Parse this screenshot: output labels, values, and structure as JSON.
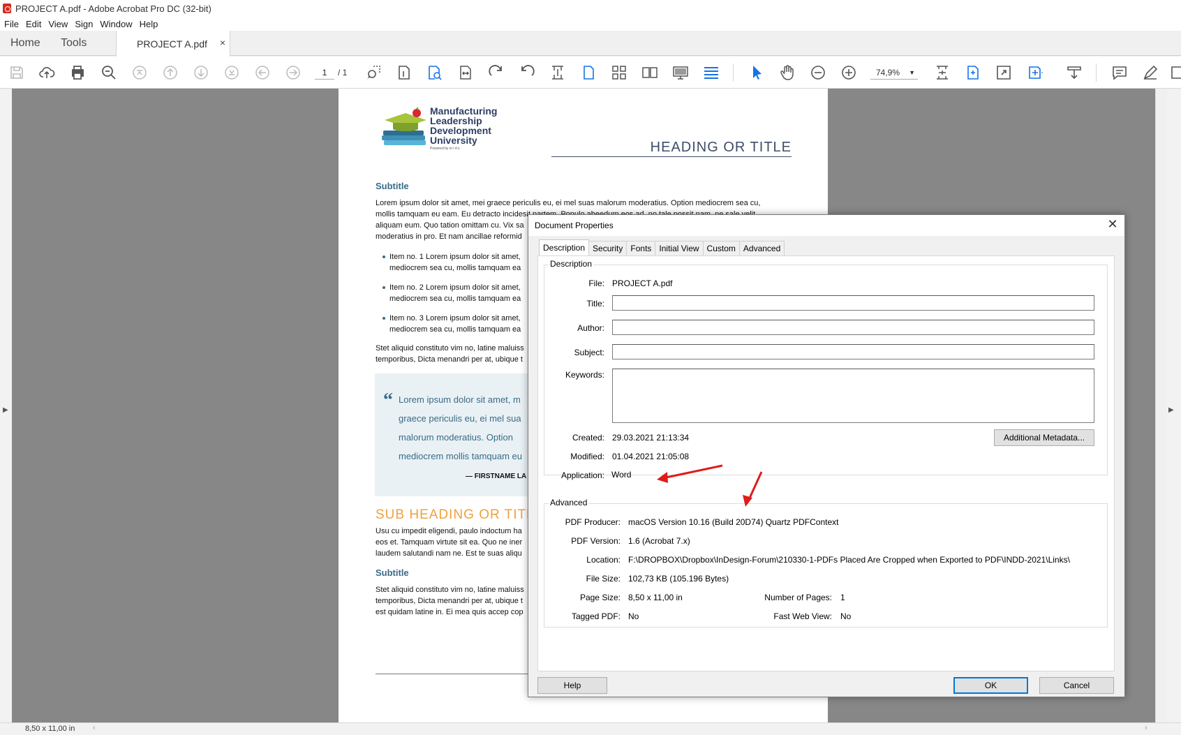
{
  "window": {
    "title": "PROJECT A.pdf - Adobe Acrobat Pro DC (32-bit)"
  },
  "menu": [
    "File",
    "Edit",
    "View",
    "Sign",
    "Window",
    "Help"
  ],
  "tabs": {
    "home": "Home",
    "tools": "Tools",
    "document": "PROJECT A.pdf",
    "close": "×"
  },
  "toolbar": {
    "page_current": "1",
    "page_total": "/ 1",
    "zoom": "74,9%"
  },
  "status": {
    "page_size": "8,50 x 11,00 in"
  },
  "pdf": {
    "logo_lines": [
      "Manufacturing",
      "Leadership",
      "Development",
      "University"
    ],
    "logo_powered": "Powered by  m l d s",
    "heading": "HEADING OR TITLE",
    "subtitle1": "Subtitle",
    "para1": [
      "Lorem ipsum dolor sit amet, mei graece periculis eu, ei mel suas malorum moderatius. Option mediocrem sea cu,",
      "mollis tamquam eu eam. Eu detracto incidesit partem. Populo abeedum eos ad, no tale possit nam, ne sale velit",
      "aliquam eum. Quo tation omittam cu. Vix sa",
      "moderatius in pro. Et nam ancillae reformid"
    ],
    "bullets": [
      [
        "Item no. 1 Lorem ipsum dolor sit amet,",
        "mediocrem sea cu, mollis tamquam ea"
      ],
      [
        "Item no. 2 Lorem ipsum dolor sit amet,",
        "mediocrem sea cu, mollis tamquam ea"
      ],
      [
        "Item no. 3 Lorem ipsum dolor sit amet,",
        "mediocrem sea cu, mollis tamquam ea"
      ]
    ],
    "para2": [
      "Stet aliquid constituto vim no, latine maluiss",
      "temporibus, Dicta menandri per at, ubique t"
    ],
    "quote": [
      "Lorem ipsum dolor sit amet, m",
      "graece periculis eu, ei mel sua",
      "malorum moderatius. Option",
      "mediocrem mollis tamquam eu"
    ],
    "quote_mark": "“",
    "quote_by": "— FIRSTNAME LA",
    "subheading": "SUB HEADING OR TITL",
    "para3": [
      "Usu cu impedit eligendi, paulo indoctum ha",
      "eos et. Tamquam virtute sit ea. Quo ne iner",
      "laudem salutandi nam ne. Est te suas aliqu"
    ],
    "subtitle2": "Subtitle",
    "para4": [
      "Stet aliquid constituto vim no, latine maluiss",
      "temporibus, Dicta menandri per at, ubique t",
      "est quidam latine in. Ei mea quis accep cop"
    ]
  },
  "dialog": {
    "title": "Document Properties",
    "close": "✕",
    "tabs": [
      "Description",
      "Security",
      "Fonts",
      "Initial View",
      "Custom",
      "Advanced"
    ],
    "description": {
      "group": "Description",
      "file_label": "File:",
      "file": "PROJECT A.pdf",
      "title_label": "Title:",
      "title": "",
      "author_label": "Author:",
      "author": "",
      "subject_label": "Subject:",
      "subject": "",
      "keywords_label": "Keywords:",
      "keywords": "",
      "created_label": "Created:",
      "created": "29.03.2021 21:13:34",
      "modified_label": "Modified:",
      "modified": "01.04.2021 21:05:08",
      "application_label": "Application:",
      "application": "Word",
      "additional_metadata": "Additional Metadata..."
    },
    "advanced": {
      "group": "Advanced",
      "producer_label": "PDF Producer:",
      "producer": "macOS Version 10.16 (Build 20D74) Quartz PDFContext",
      "version_label": "PDF Version:",
      "version": "1.6 (Acrobat 7.x)",
      "location_label": "Location:",
      "location": "F:\\DROPBOX\\Dropbox\\InDesign-Forum\\210330-1-PDFs Placed Are Cropped when Exported to PDF\\INDD-2021\\Links\\",
      "filesize_label": "File Size:",
      "filesize": "102,73 KB (105.196 Bytes)",
      "pagesize_label": "Page Size:",
      "pagesize": "8,50 x 11,00 in",
      "numpages_label": "Number of Pages:",
      "numpages": "1",
      "tagged_label": "Tagged PDF:",
      "tagged": "No",
      "fastweb_label": "Fast Web View:",
      "fastweb": "No"
    },
    "buttons": {
      "help": "Help",
      "ok": "OK",
      "cancel": "Cancel"
    }
  },
  "colors": {
    "annotation_arrow": "#e01b1b",
    "primary_button_border": "#0078d7",
    "toolbar_accent": "#1473e6"
  }
}
